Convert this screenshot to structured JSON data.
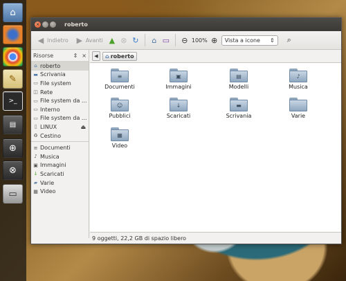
{
  "window": {
    "title": "roberto"
  },
  "toolbar": {
    "back_label": "Indietro",
    "forward_label": "Avanti",
    "zoom_level": "100%",
    "view_mode": "Vista a icone"
  },
  "sidebar": {
    "header": "Risorse",
    "close_glyph": "×",
    "devices": [
      {
        "label": "roberto",
        "icon": "home-icon"
      },
      {
        "label": "Scrivania",
        "icon": "desktop-icon"
      },
      {
        "label": "File system",
        "icon": "drive-icon"
      },
      {
        "label": "Rete",
        "icon": "network-icon"
      },
      {
        "label": "File system da ...",
        "icon": "drive-icon"
      },
      {
        "label": "Interno",
        "icon": "drive-icon"
      },
      {
        "label": "File system da ...",
        "icon": "drive-icon"
      },
      {
        "label": "LINUX",
        "icon": "usb-icon"
      },
      {
        "label": "Cestino",
        "icon": "trash-icon"
      }
    ],
    "bookmarks": [
      {
        "label": "Documenti",
        "icon": "documents-icon"
      },
      {
        "label": "Musica",
        "icon": "music-icon"
      },
      {
        "label": "Immagini",
        "icon": "pictures-icon"
      },
      {
        "label": "Scaricati",
        "icon": "downloads-icon"
      },
      {
        "label": "Varie",
        "icon": "folder-icon"
      },
      {
        "label": "Video",
        "icon": "video-icon"
      }
    ]
  },
  "pathbar": {
    "current": "roberto"
  },
  "files": [
    {
      "label": "Documenti",
      "emblem": "≡"
    },
    {
      "label": "Immagini",
      "emblem": "▣"
    },
    {
      "label": "Modelli",
      "emblem": "▤"
    },
    {
      "label": "Musica",
      "emblem": "♪"
    },
    {
      "label": "Pubblici",
      "emblem": "☺"
    },
    {
      "label": "Scaricati",
      "emblem": "↓"
    },
    {
      "label": "Scrivania",
      "emblem": "▬"
    },
    {
      "label": "Varie",
      "emblem": ""
    },
    {
      "label": "Video",
      "emblem": "▦"
    }
  ],
  "status": "9 oggetti, 22,2 GB di spazio libero",
  "colors": {
    "accent": "#df4a16",
    "folder": "#8ea7c0",
    "selection": "#d8d6d0"
  }
}
